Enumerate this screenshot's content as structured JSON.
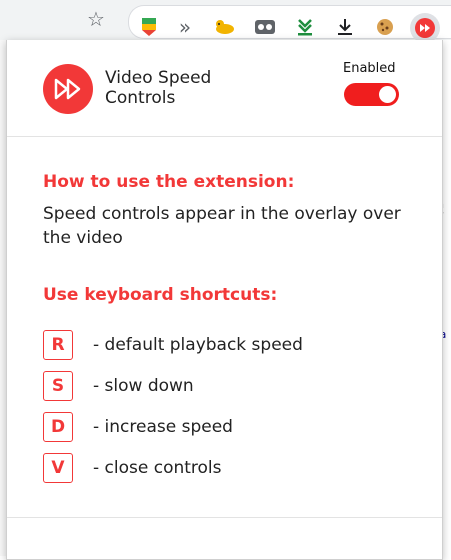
{
  "toolbar": {
    "extensions": [
      {
        "name": "bookmark-extension-icon",
        "glyph": "🔖",
        "color": "#1a73e8"
      },
      {
        "name": "forward-extension-icon",
        "glyph": "»",
        "color": "#5f6368"
      },
      {
        "name": "cat-extension-icon",
        "glyph": "🐆",
        "color": "#e6a700"
      },
      {
        "name": "mask-extension-icon",
        "glyph": "◘",
        "color": "#5f6368"
      },
      {
        "name": "download-green-extension-icon",
        "glyph": "⇓",
        "color": "#1e8e3e"
      },
      {
        "name": "download-extension-icon",
        "glyph": "⤓",
        "color": "#202124"
      },
      {
        "name": "cookie-extension-icon",
        "glyph": "🍪",
        "color": "#c58c3a"
      },
      {
        "name": "video-speed-extension-icon",
        "glyph": "⏩",
        "color": "#f23838"
      }
    ]
  },
  "popup": {
    "title_line1": "Video Speed",
    "title_line2": "Controls",
    "enabled_label": "Enabled",
    "enabled": true,
    "how_to_heading": "How to use the extension:",
    "how_to_text": "Speed controls appear in the overlay over the video",
    "shortcuts_heading": "Use keyboard shortcuts:",
    "shortcuts": [
      {
        "key": "R",
        "description": "- default playback speed"
      },
      {
        "key": "S",
        "description": "- slow down"
      },
      {
        "key": "D",
        "description": "- increase speed"
      },
      {
        "key": "V",
        "description": "- close controls"
      }
    ]
  },
  "colors": {
    "accent": "#f23838",
    "toggle": "#f01e1e",
    "text": "#222222"
  }
}
